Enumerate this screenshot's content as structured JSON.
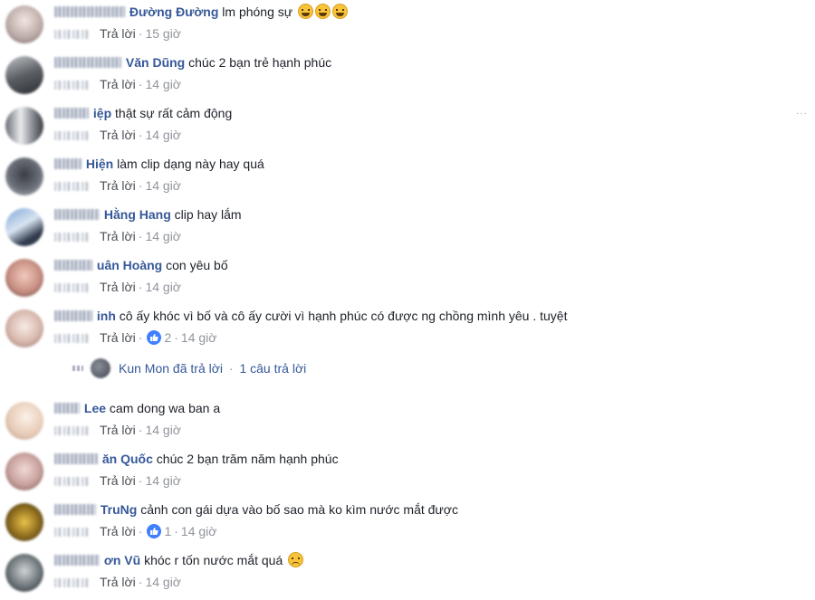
{
  "colors": {
    "author": "#365899",
    "meta": "#90949c",
    "like": "#4080ff"
  },
  "comments": [
    {
      "author": "Đường Đường",
      "text": "lm phóng sự",
      "reply": "Trả lời",
      "time": "15 giờ",
      "emoji": "laugh"
    },
    {
      "author": "Văn Dũng",
      "text": "chúc 2 bạn trẻ hạnh phúc",
      "reply": "Trả lời",
      "time": "14 giờ"
    },
    {
      "author": "iệp",
      "text": "thật sự rất cảm động",
      "reply": "Trả lời",
      "time": "14 giờ"
    },
    {
      "author": "Hiện",
      "text": "làm clip dạng này hay quá",
      "reply": "Trả lời",
      "time": "14 giờ"
    },
    {
      "author": "Hằng Hang",
      "text": "clip hay lắm",
      "reply": "Trả lời",
      "time": "14 giờ"
    },
    {
      "author": "uân Hoàng",
      "text": "con yêu bố",
      "reply": "Trả lời",
      "time": "14 giờ"
    },
    {
      "author": "inh",
      "text": "cô ấy khóc vì bố và cô ấy cười vì hạnh phúc có được ng chồng mình yêu . tuyệt",
      "reply": "Trả lời",
      "likes": "2",
      "time": "14 giờ"
    },
    {
      "author": "Lee",
      "text": "cam dong wa ban a",
      "reply": "Trả lời",
      "time": "14 giờ"
    },
    {
      "author": "ăn Quốc",
      "text": "chúc 2 bạn trăm năm hạnh phúc",
      "reply": "Trả lời",
      "time": "14 giờ"
    },
    {
      "author": "TruNg",
      "text": "cảnh con gái dựa vào bố sao mà ko kìm nước mắt được",
      "reply": "Trả lời",
      "likes": "1",
      "time": "14 giờ"
    },
    {
      "author": "ơn Vũ",
      "text": "khóc r tốn nước mắt quá",
      "reply": "Trả lời",
      "time": "14 giờ",
      "emoji": "sad"
    }
  ],
  "reply_summary": {
    "who": "Kun Mon đã trả lời",
    "sep": "·",
    "count": "1 câu trả lời"
  },
  "more_icon": "···"
}
